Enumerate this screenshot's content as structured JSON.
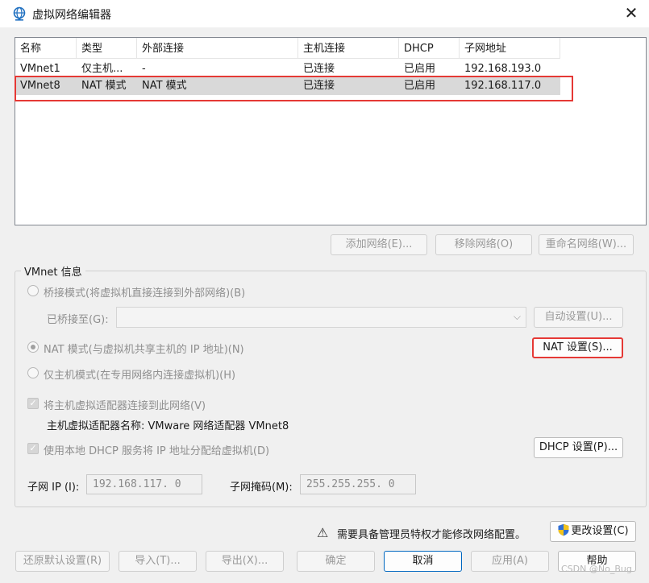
{
  "window": {
    "title": "虚拟网络编辑器"
  },
  "list": {
    "columns": [
      "名称",
      "类型",
      "外部连接",
      "主机连接",
      "DHCP",
      "子网地址"
    ],
    "rows": [
      {
        "name": "VMnet1",
        "type": "仅主机...",
        "external": "-",
        "host": "已连接",
        "dhcp": "已启用",
        "subnet": "192.168.193.0"
      },
      {
        "name": "VMnet8",
        "type": "NAT 模式",
        "external": "NAT 模式",
        "host": "已连接",
        "dhcp": "已启用",
        "subnet": "192.168.117.0"
      }
    ]
  },
  "list_buttons": {
    "add": "添加网络(E)...",
    "remove": "移除网络(O)",
    "rename": "重命名网络(W)..."
  },
  "vmnet_info": {
    "title": "VMnet 信息",
    "bridged_label": "桥接模式(将虚拟机直接连接到外部网络)(B)",
    "bridged_to_label": "已桥接至(G):",
    "bridged_to_value": "",
    "auto_settings": "自动设置(U)...",
    "nat_label": "NAT 模式(与虚拟机共享主机的 IP 地址)(N)",
    "nat_settings": "NAT 设置(S)...",
    "hostonly_label": "仅主机模式(在专用网络内连接虚拟机)(H)",
    "connect_adapter_label": "将主机虚拟适配器连接到此网络(V)",
    "adapter_name_label": "主机虚拟适配器名称: VMware 网络适配器 VMnet8",
    "dhcp_label": "使用本地 DHCP 服务将 IP 地址分配给虚拟机(D)",
    "dhcp_settings": "DHCP 设置(P)...",
    "subnet_ip_label": "子网 IP (I):",
    "subnet_ip_value": "192.168.117. 0",
    "subnet_mask_label": "子网掩码(M):",
    "subnet_mask_value": "255.255.255. 0"
  },
  "admin": {
    "notice": "需要具备管理员特权才能修改网络配置。",
    "change_settings": "更改设置(C)"
  },
  "footer_buttons": {
    "restore": "还原默认设置(R)",
    "import": "导入(T)...",
    "export": "导出(X)...",
    "ok": "确定",
    "cancel": "取消",
    "apply": "应用(A)",
    "help": "帮助"
  },
  "watermark": "CSDN @No_Bug",
  "colors": {
    "highlight_red": "#e53935",
    "selected_row": "#d9d9d9",
    "accent_blue": "#0067c0"
  }
}
